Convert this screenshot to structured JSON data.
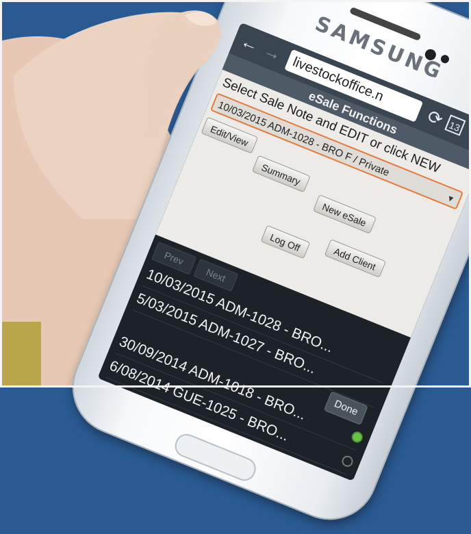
{
  "photo": {
    "colors": {
      "background": "#2a5a92",
      "skin": "#e6c8b4",
      "accent": "#e47b3a"
    }
  },
  "phone": {
    "brand": "SAMSUNG",
    "browser": {
      "back_icon": "←",
      "forward_icon": "→",
      "url": "livestockoffice.n",
      "reload_icon": "⟳",
      "tabs_count": "13",
      "bookmark_icon": "★"
    },
    "app": {
      "header": "eSale Functions",
      "instruction": "Select Sale Note and EDIT or click NEW",
      "selected_sale": "10/03/2015 ADM-1028 - BRO F / Private",
      "buttons": {
        "edit_view": "Edit/View",
        "summary": "Summary",
        "new_esale": "New eSale",
        "add_client": "Add Client",
        "log_off": "Log Off"
      }
    },
    "picker": {
      "prev": "Prev",
      "next": "Next",
      "done": "Done",
      "items": [
        "10/03/2015 ADM-1028 - BRO...",
        "5/03/2015 ADM-1027 - BRO...",
        "30/09/2014 ADM-1018 - BRO...",
        "6/08/2014 GUE-1025 - BRO..."
      ]
    }
  }
}
